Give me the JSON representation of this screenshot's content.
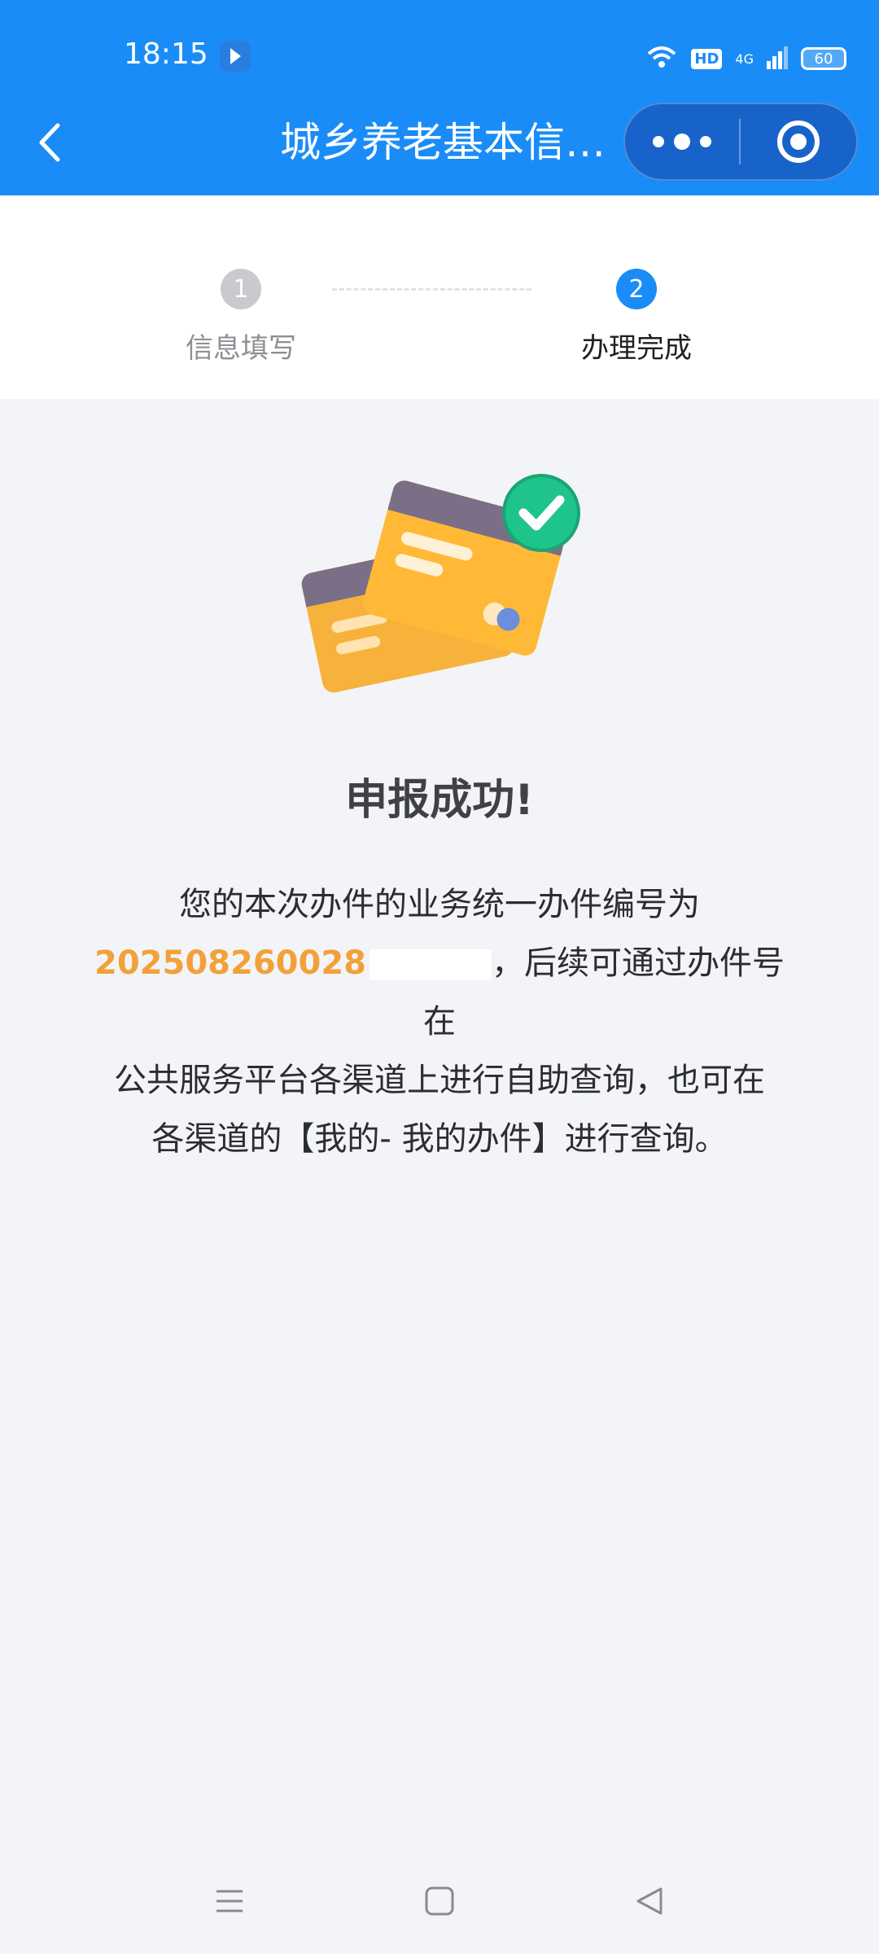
{
  "status_bar": {
    "time": "18:15",
    "hd": "HD",
    "network": "4G",
    "battery": "60"
  },
  "nav": {
    "title": "城乡养老基本信…",
    "back_icon": "chevron-left-icon",
    "more_icon": "more-dots-icon",
    "close_icon": "target-close-icon"
  },
  "steps": [
    {
      "number": "1",
      "label": "信息填写",
      "state": "done",
      "color": "#c9cacd"
    },
    {
      "number": "2",
      "label": "办理完成",
      "state": "active",
      "color": "#1a8cf7"
    }
  ],
  "result": {
    "title": "申报成功!",
    "line1": "您的本次办件的业务统一办件编号为",
    "order_number": "202508260028",
    "line2_suffix": "，后续可通过办件号在",
    "line3": "公共服务平台各渠道上进行自助查询，也可在",
    "line4": "各渠道的【我的- 我的办件】进行查询。"
  },
  "colors": {
    "header_blue": "#1a8cf7",
    "accent_orange": "#f2a13a",
    "success_green": "#1fc48a",
    "background": "#f3f4f8"
  }
}
